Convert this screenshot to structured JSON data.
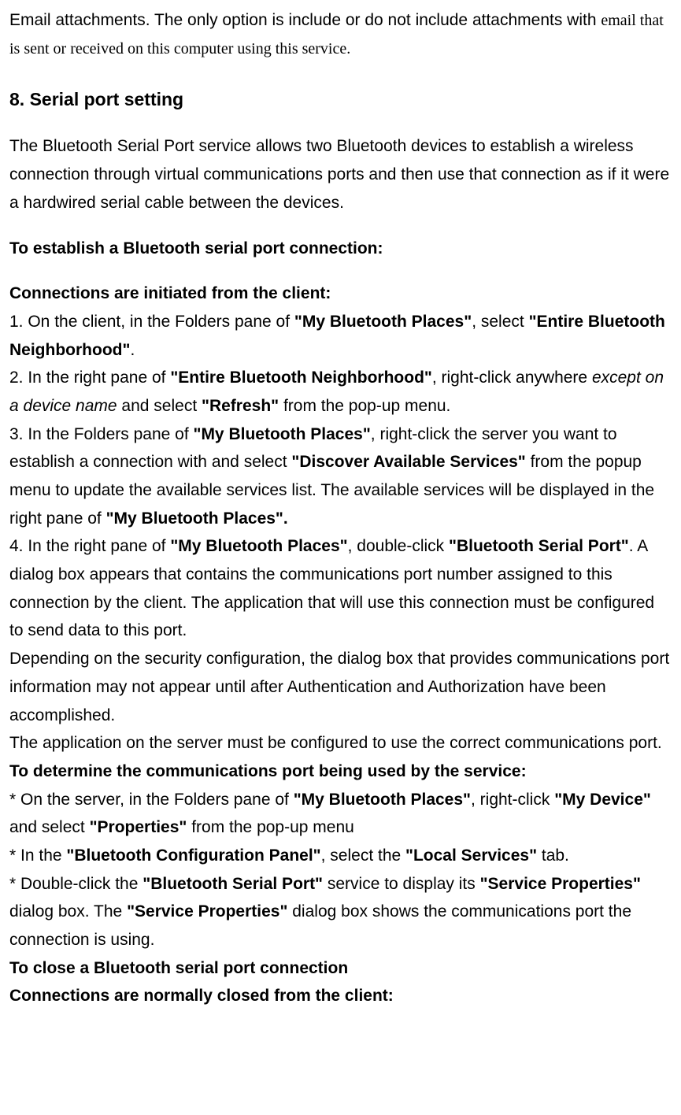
{
  "intro": {
    "line1_a": "Email attachments. The only option is include or do not include attachments with ",
    "line1_b": "email that is sent or received on this computer using this service."
  },
  "heading": "8. Serial port setting",
  "desc": "The Bluetooth Serial Port service allows two Bluetooth devices to establish a wireless connection through virtual communications ports and then use that connection as if it were a hardwired serial cable between the devices.",
  "establish_heading": "To establish a Bluetooth serial port connection:",
  "conn_heading": "Connections are initiated from the client:",
  "step1": {
    "a": "1. On the client, in the Folders pane of ",
    "b": "\"My Bluetooth Places\"",
    "c": ", select ",
    "d": "\"Entire Bluetooth Neighborhood\"",
    "e": "."
  },
  "step2": {
    "a": "2. In the right pane of ",
    "b": "\"Entire Bluetooth Neighborhood\"",
    "c": ", right-click anywhere ",
    "d": "except on a device name",
    "e": " and select ",
    "f": "\"Refresh\"",
    "g": " from the pop-up menu."
  },
  "step3": {
    "a": "3. In the Folders pane of ",
    "b": "\"My Bluetooth Places\"",
    "c": ", right-click the server you want to establish a connection with and select ",
    "d": "\"Discover Available Services\"",
    "e": " from the popup menu to update the available services list. The available services will be displayed in the right pane of ",
    "f": "\"My Bluetooth Places\"."
  },
  "step4": {
    "a": "4. In the right pane of ",
    "b": "\"My Bluetooth Places\"",
    "c": ", double-click ",
    "d": "\"Bluetooth Serial Port\"",
    "e": ". A dialog box appears that contains the communications port number assigned to this connection by the client. The application that will use this connection must be configured to send data to this port."
  },
  "depending": "Depending on the security configuration, the dialog box that provides communications port information may not appear until after Authentication and Authorization have been accomplished.",
  "server_app": "The application on the server must be configured to use the correct communications port.",
  "determine_heading": "To determine the communications port being used by the service:",
  "bullet1": {
    "a": "* On the server, in the Folders pane of ",
    "b": "\"My Bluetooth Places\"",
    "c": ", right-click ",
    "d": "\"My Device\"",
    "e": " and select ",
    "f": "\"Properties\"",
    "g": " from the pop-up menu"
  },
  "bullet2": {
    "a": "* In the ",
    "b": "\"Bluetooth Configuration Panel\"",
    "c": ", select the ",
    "d": "\"Local Services\"",
    "e": " tab."
  },
  "bullet3": {
    "a": "* Double-click the ",
    "b": "\"Bluetooth Serial Port\"",
    "c": " service to display its ",
    "d": "\"Service Properties\"",
    "e": " dialog box. The ",
    "f": "\"Service Properties\"",
    "g": " dialog box shows the communications port the connection is using."
  },
  "close_heading": "To close a Bluetooth serial port connection",
  "close_sub": "Connections are normally closed from the client:"
}
